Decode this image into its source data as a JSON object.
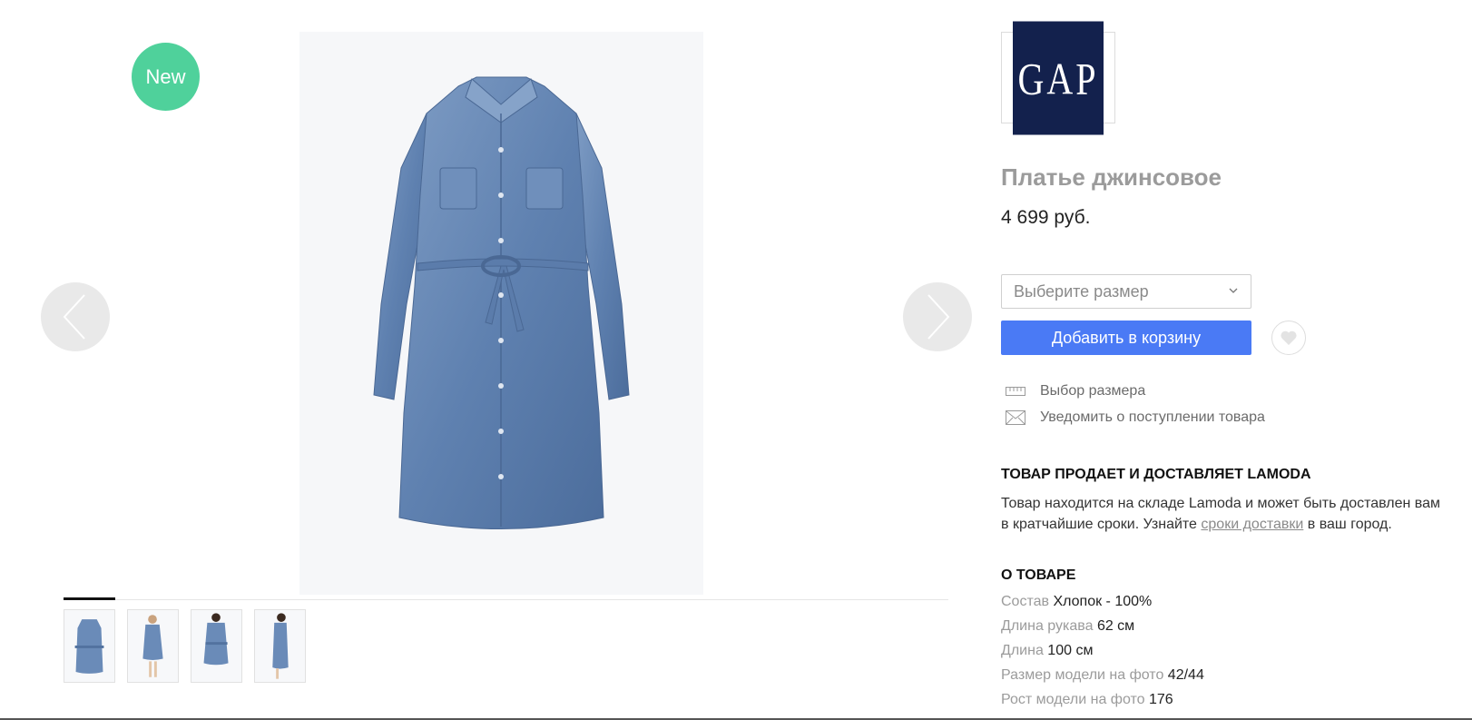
{
  "gallery": {
    "badge": "New",
    "thumbnails": [
      "front-view",
      "model-front",
      "model-belted",
      "model-side"
    ],
    "active_thumbnail": 0
  },
  "brand": {
    "name": "GAP",
    "logo_color": "#13214d"
  },
  "product": {
    "title": "Платье джинсовое",
    "price": "4 699 руб."
  },
  "actions": {
    "size_placeholder": "Выберите размер",
    "add_to_cart": "Добавить в корзину",
    "accent": "#4a7af5"
  },
  "links": {
    "size_guide": "Выбор размера",
    "notify": "Уведомить о поступлении товара"
  },
  "seller": {
    "heading": "ТОВАР ПРОДАЕТ И ДОСТАВЛЯЕТ LAMODA",
    "text_before": "Товар находится на складе Lamoda и может быть доставлен вам в кратчайшие сроки. Узнайте ",
    "link": "сроки доставки",
    "text_after": " в ваш город."
  },
  "about": {
    "heading": "О ТОВАРЕ",
    "attributes": [
      {
        "label": "Состав",
        "value": "Хлопок - 100%"
      },
      {
        "label": "Длина рукава",
        "value": "62 см"
      },
      {
        "label": "Длина",
        "value": "100 см"
      },
      {
        "label": "Размер модели на фото",
        "value": "42/44"
      },
      {
        "label": "Рост модели на фото",
        "value": "176"
      }
    ]
  }
}
